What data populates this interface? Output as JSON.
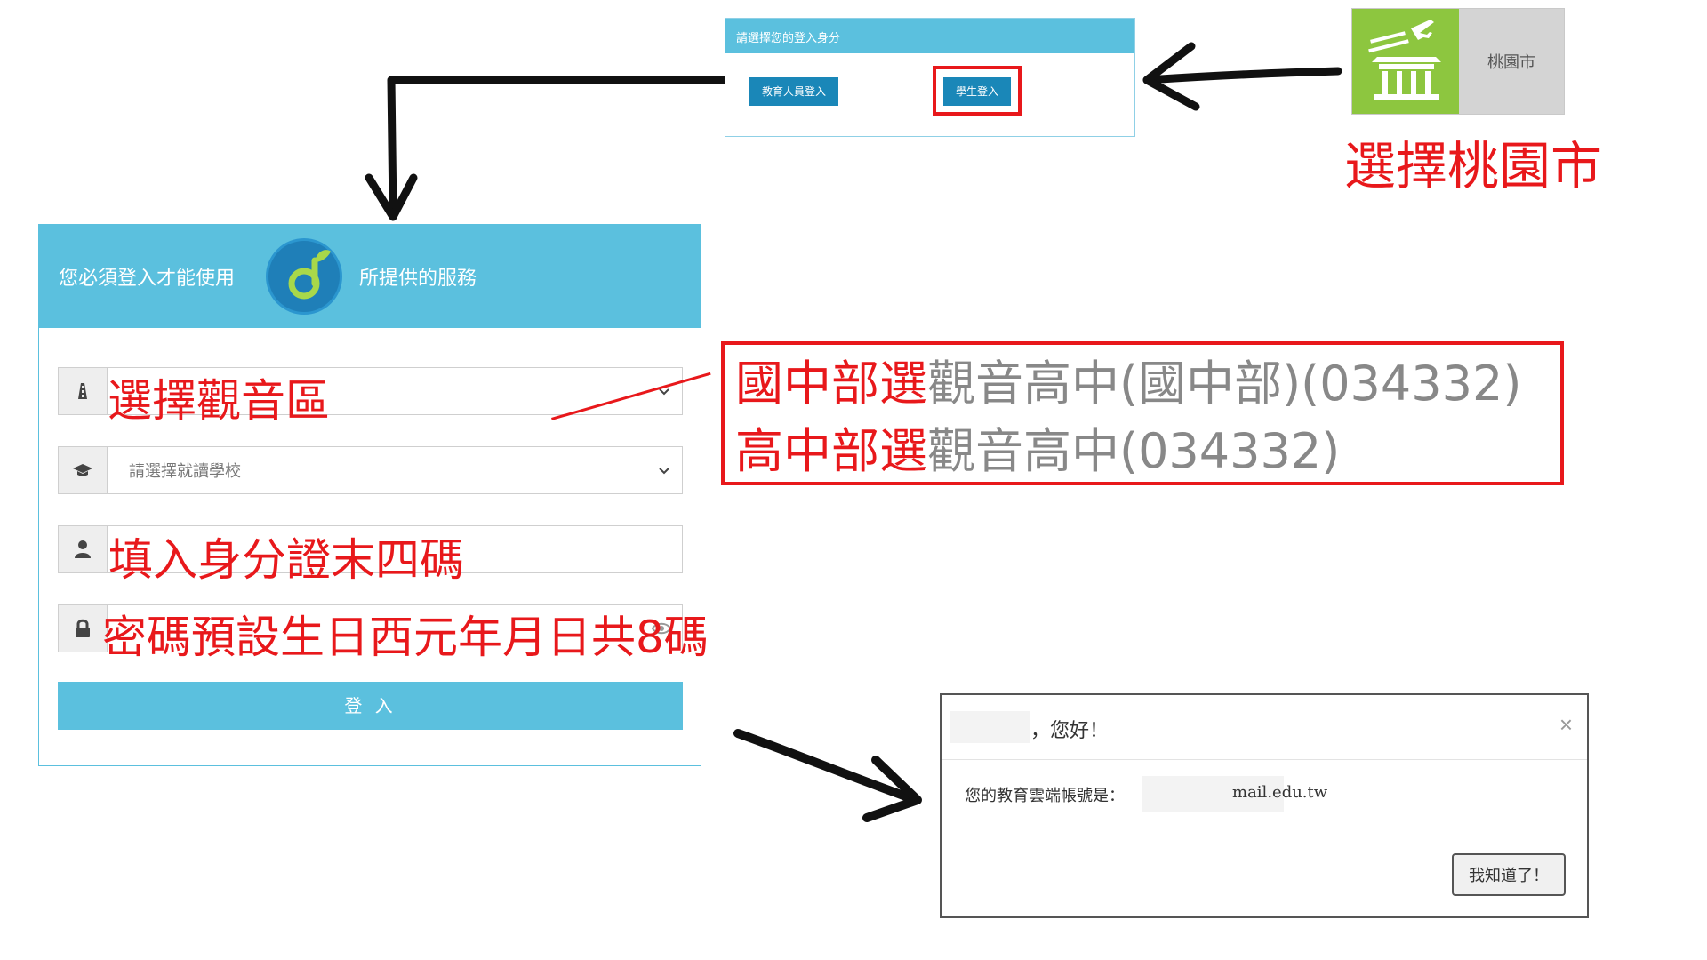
{
  "role_panel": {
    "title": "請選擇您的登入身分",
    "teacher_button": "教育人員登入",
    "student_button": "學生登入"
  },
  "city_tile": {
    "name": "桃園市"
  },
  "annotations": {
    "city": "選擇桃園市",
    "district": "選擇觀音區",
    "id": "填入身分證末四碼",
    "password": "密碼預設生日西元年月日共8碼",
    "junior_prefix": "國中部選",
    "junior_school": "觀音高中(國中部)(034332)",
    "senior_prefix": "高中部選",
    "senior_school": "觀音高中(034332)"
  },
  "login_panel": {
    "header_left": "您必須登入才能使用",
    "header_right": "所提供的服務",
    "school_placeholder": "請選擇就讀學校",
    "login_button": "登 入"
  },
  "dialog": {
    "greeting": "，您好！",
    "close": "×",
    "account_label": "您的教育雲端帳號是：",
    "account_value": "mail.edu.tw",
    "ok_button": "我知道了！"
  },
  "colors": {
    "accent": "#5bc0de",
    "button": "#1a87b8",
    "annotation": "#e8181b",
    "city_green": "#8dc63f"
  }
}
